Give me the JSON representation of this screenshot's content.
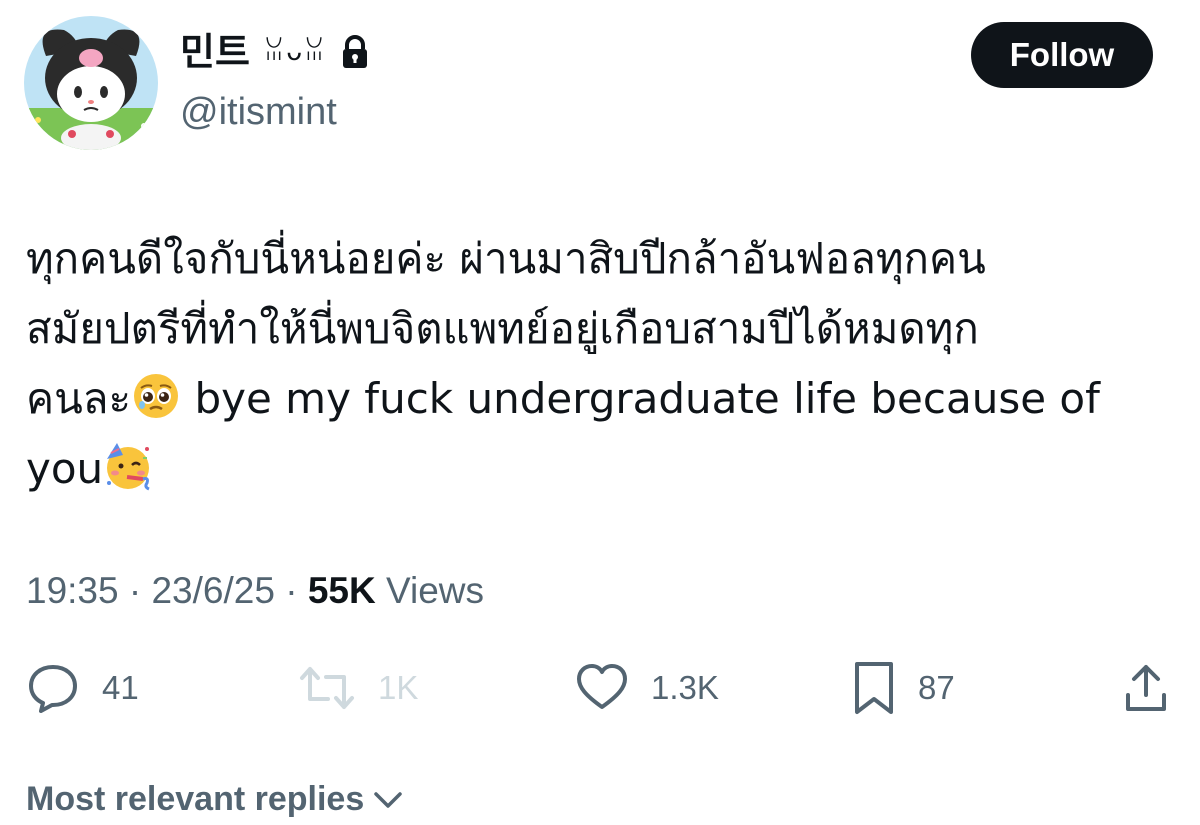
{
  "profile": {
    "display_name": "민트",
    "name_emoji": "ꈍᴗꈍ",
    "handle": "@itismint",
    "avatar_icon": "kuromi-avatar",
    "lock_icon": "lock-icon"
  },
  "follow_label": "Follow",
  "tweet": {
    "lines": [
      "ทุกคนดีใจกับนี่หน่อยค่ะ ผ่านมาสิบปีกล้าอันฟอลทุกคน",
      "สมัยปตรีที่ทำให้นี่พบจิตแพทย์อยู่เกือบสามปีได้หมดทุก",
      "คนละ",
      " bye my fuck undergraduate life because of",
      "you"
    ],
    "emojis": [
      "pleading-face-emoji",
      "partying-face-emoji"
    ]
  },
  "meta": {
    "time": "19:35",
    "separator": " · ",
    "date": "23/6/25",
    "views_count": "55K",
    "views_label": " Views"
  },
  "actions": {
    "reply": "41",
    "retweet": "1K",
    "like": "1.3K",
    "bookmark": "87"
  },
  "replies_header": "Most relevant replies",
  "colors": {
    "text_primary": "#0f1419",
    "text_secondary": "#536471",
    "disabled": "#cfd9de",
    "button_bg": "#0f1419"
  }
}
